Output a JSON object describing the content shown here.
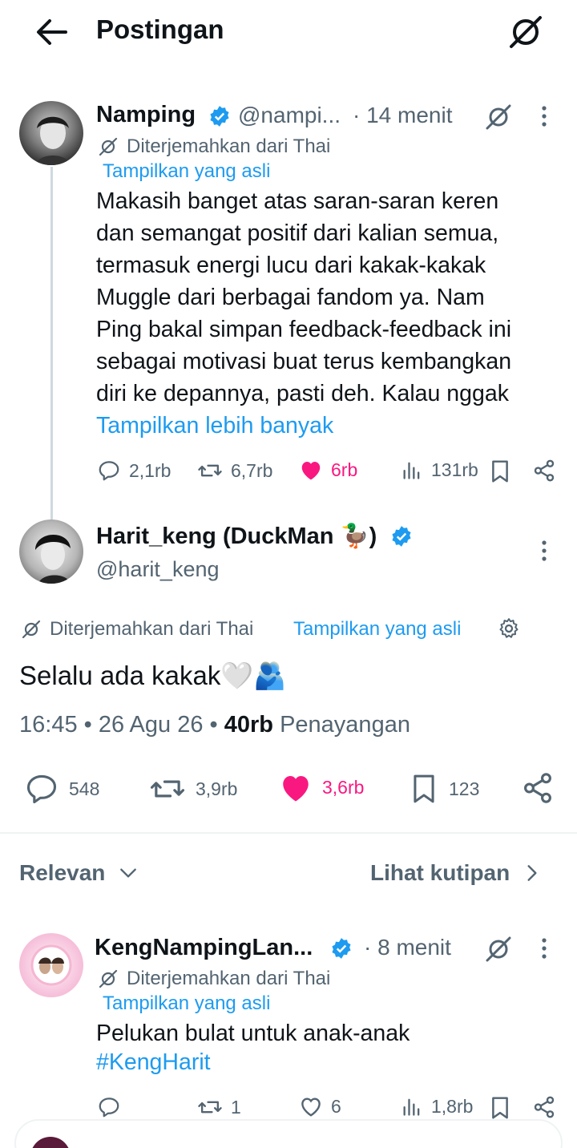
{
  "header": {
    "title": "Postingan"
  },
  "tweet1": {
    "name": "Namping",
    "handle": "@nampi...",
    "time": "· 14 menit",
    "translated": "Diterjemahkan dari Thai",
    "show_original": "Tampilkan yang asli",
    "lines": [
      "Makasih banget atas saran-saran keren",
      "dan semangat positif dari kalian semua,",
      "termasuk energi lucu dari kakak-kakak",
      "Muggle dari berbagai fandom ya. Nam",
      "Ping bakal simpan feedback-feedback ini",
      "sebagai motivasi buat terus kembangkan",
      "diri ke depannya, pasti deh. Kalau nggak"
    ],
    "show_more": "Tampilkan lebih banyak",
    "replies": "2,1rb",
    "reposts": "6,7rb",
    "likes": "6rb",
    "views": "131rb"
  },
  "main": {
    "name": "Harit_keng (DuckMan 🦆)",
    "handle": "@harit_keng",
    "translated": "Diterjemahkan dari Thai",
    "show_original": "Tampilkan yang asli",
    "text": "Selalu ada kakak🤍🫂",
    "time": "16:45 • 26 Agu 26 •",
    "views_count": "40rb",
    "views_label": "Penayangan",
    "replies": "548",
    "reposts": "3,9rb",
    "likes": "3,6rb",
    "bookmarks": "123"
  },
  "sort": {
    "label": "Relevan",
    "quotes": "Lihat kutipan"
  },
  "reply1": {
    "name": "KengNampingLan...",
    "time": "· 8 menit",
    "translated": "Diterjemahkan dari Thai",
    "show_original": "Tampilkan yang asli",
    "text": "Pelukan bulat untuk anak-anak",
    "hashtag": "#KengHarit",
    "replies": "",
    "reposts": "1",
    "likes": "6",
    "views": "1,8rb"
  },
  "colors": {
    "blue": "#1d9bf0",
    "pink": "#f91880",
    "text": "#0f1419",
    "muted": "#536471"
  }
}
